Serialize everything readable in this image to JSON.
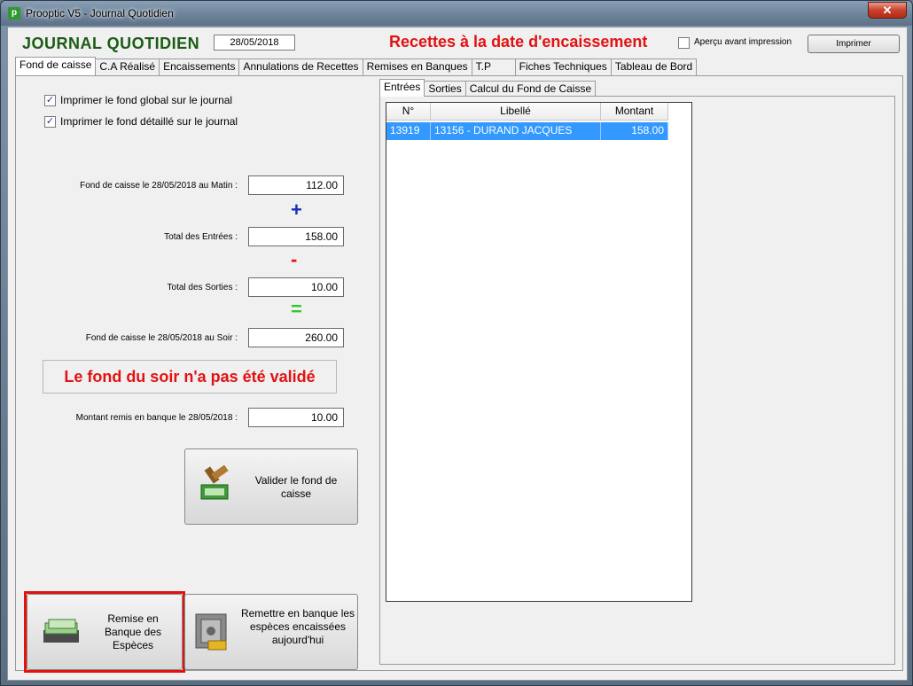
{
  "window": {
    "title": "Prooptic V5 - Journal Quotidien",
    "icon": "p-app-icon",
    "close_glyph": "✕"
  },
  "header": {
    "title": "JOURNAL QUOTIDIEN",
    "date": "28/05/2018",
    "subtitle": "Recettes à la date d'encaissement",
    "apercu_label": "Aperçu avant impression",
    "apercu_checked": false,
    "print_button": "Imprimer"
  },
  "tabs": [
    {
      "label": "Fond de caisse",
      "active": true
    },
    {
      "label": "C.A Réalisé"
    },
    {
      "label": "Encaissements"
    },
    {
      "label": "Annulations de Recettes"
    },
    {
      "label": "Remises en Banques"
    },
    {
      "label": "T.P"
    },
    {
      "label": "Fiches Techniques"
    },
    {
      "label": "Tableau de Bord"
    }
  ],
  "fond": {
    "chk_global": {
      "label": "Imprimer le fond global sur le journal",
      "checked": true
    },
    "chk_detail": {
      "label": "Imprimer le fond détaillé sur le journal",
      "checked": true
    },
    "matin_label": "Fond de caisse le 28/05/2018 au Matin :",
    "matin_value": "112.00",
    "plus": "+",
    "entrees_label": "Total des Entrées :",
    "entrees_value": "158.00",
    "minus": "-",
    "sorties_label": "Total des Sorties :",
    "sorties_value": "10.00",
    "equals": "=",
    "soir_label": "Fond de caisse le 28/05/2018 au Soir :",
    "soir_value": "260.00",
    "warning": "Le fond du soir n'a pas été validé",
    "remis_label": "Montant remis en banque le 28/05/2018 :",
    "remis_value": "10.00",
    "valider_btn": "Valider le fond de caisse",
    "remise_btn": "Remise en Banque des Espèces",
    "remettre_btn": "Remettre en banque les espèces encaissées aujourd'hui"
  },
  "sub_tabs": [
    {
      "label": "Entrées",
      "active": true
    },
    {
      "label": "Sorties"
    },
    {
      "label": "Calcul du Fond de Caisse"
    }
  ],
  "grid": {
    "columns": [
      "N°",
      "Libellé",
      "Montant"
    ],
    "rows": [
      [
        "13919",
        "13156 - DURAND JACQUES",
        "158.00"
      ]
    ]
  },
  "colors": {
    "accent_green": "#1a5c14",
    "alert_red": "#e31212",
    "selection_blue": "#3399ff"
  }
}
